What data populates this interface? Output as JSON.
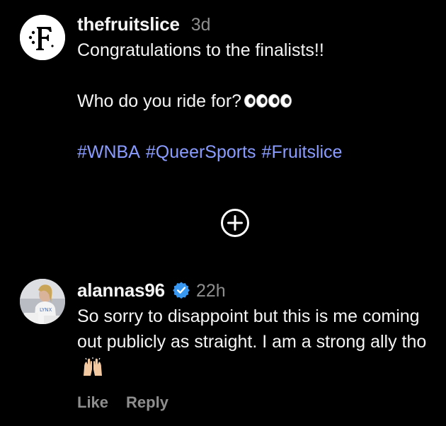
{
  "caption": {
    "avatar_icon": "fruitslice-logo-icon",
    "username": "thefruitslice",
    "time": "3d",
    "lines": [
      "Congratulations to the finalists!!",
      "Who do you ride for?"
    ],
    "emoji": "eyes-icon",
    "hashtags": [
      "#WNBA",
      "#QueerSports",
      "#Fruitslice"
    ]
  },
  "add_icon": "plus-circle-icon",
  "comment": {
    "avatar_icon": "user-avatar-photo",
    "username": "alannas96",
    "verified_icon": "verified-badge-icon",
    "time": "22h",
    "text": "So sorry to disappoint but this is me coming out publicly as straight. I am a strong ally tho",
    "emoji": "raised-hands-icon",
    "actions": {
      "like": "Like",
      "reply": "Reply"
    }
  },
  "colors": {
    "background": "#000000",
    "text": "#f5f5f5",
    "muted": "#8e8e8e",
    "hashtag": "#8a9cff",
    "verified": "#3897f0"
  }
}
